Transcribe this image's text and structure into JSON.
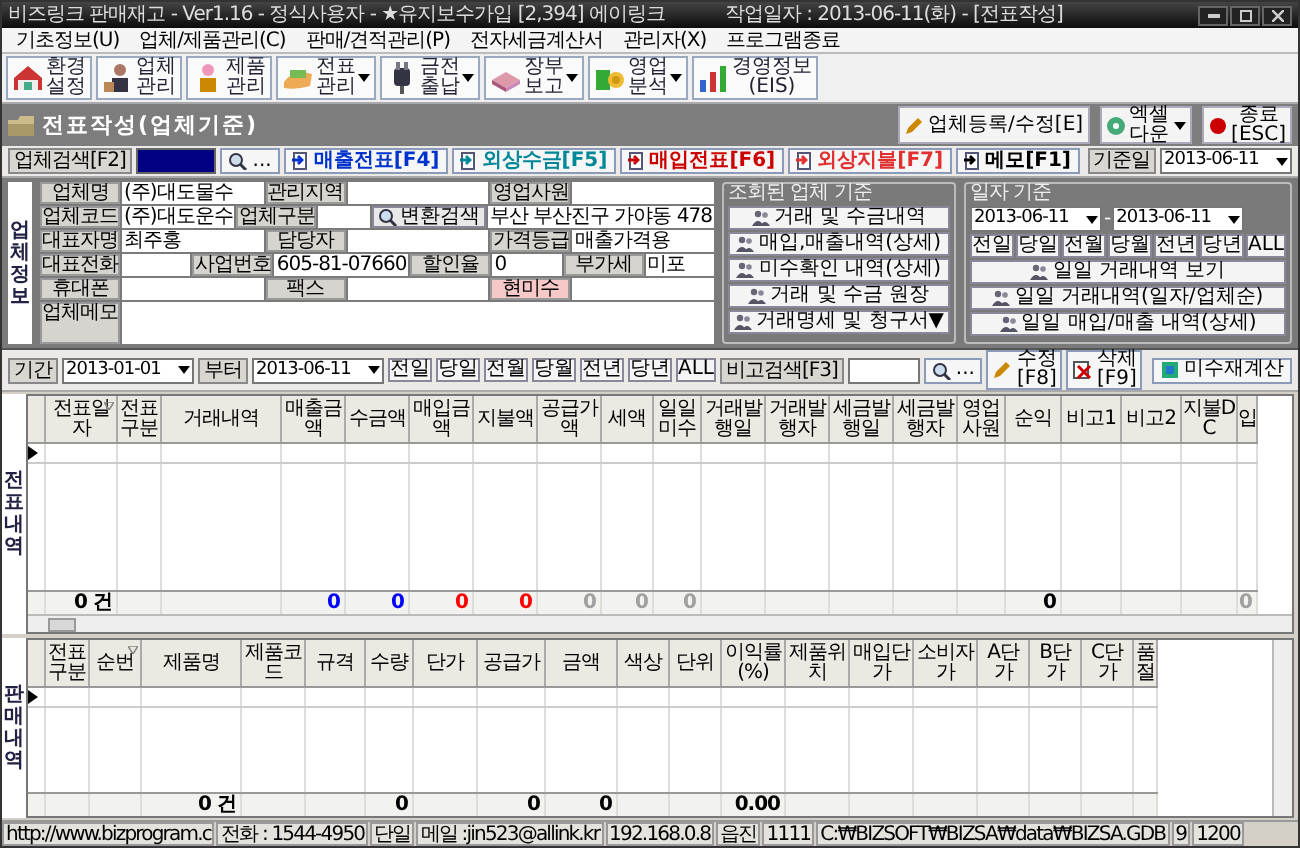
{
  "window": {
    "title": "비즈링크 판매재고 - Ver1.16 - 정식사용자 - ★유지보수가입 [2,394] 에이링크",
    "work_date": "작업일자 : 2013-06-11(화) - [전표작성]"
  },
  "menu": [
    "기초정보(U)",
    "업체/제품관리(C)",
    "판매/견적관리(P)",
    "전자세금계산서",
    "관리자(X)",
    "프로그램종료"
  ],
  "toolbar": [
    {
      "label": "환경\n설정",
      "dropdown": false
    },
    {
      "label": "업체\n관리",
      "dropdown": false
    },
    {
      "label": "제품\n관리",
      "dropdown": false
    },
    {
      "label": "전표\n관리",
      "dropdown": true
    },
    {
      "label": "금전\n출납",
      "dropdown": true
    },
    {
      "label": "장부\n보고",
      "dropdown": true
    },
    {
      "label": "영업\n분석",
      "dropdown": true
    },
    {
      "label": "경영정보\n(EIS)",
      "dropdown": false
    }
  ],
  "section": {
    "title": "전표작성(업체기준)",
    "buttons": [
      {
        "label": "업체등록/수정[E]",
        "dropdown": false
      },
      {
        "label": "엑셀\n다운",
        "dropdown": true
      },
      {
        "label": "종료\n[ESC]",
        "dropdown": false
      }
    ]
  },
  "search": {
    "label": "업체검색[F2]",
    "browse": "...",
    "actions": [
      {
        "label": "매출전표[F4]",
        "color": "#0033cc"
      },
      {
        "label": "외상수금[F5]",
        "color": "#008899"
      },
      {
        "label": "매입전표[F6]",
        "color": "#cc0000"
      },
      {
        "label": "외상지불[F7]",
        "color": "#e03030"
      },
      {
        "label": "메모[F1]",
        "color": "#000000"
      }
    ],
    "date_label": "기준일",
    "date": "2013-06-11"
  },
  "vendor": {
    "side_label": "업체정보",
    "rows": [
      {
        "kind": "line",
        "cells": [
          {
            "kind": "label",
            "text": "업체명"
          },
          {
            "kind": "value",
            "text": "(주)대도물수"
          },
          {
            "kind": "label",
            "text": "관리지역"
          },
          {
            "kind": "value"
          },
          {
            "kind": "label",
            "text": "영업사원"
          },
          {
            "kind": "value"
          }
        ]
      },
      {
        "kind": "line",
        "cells": [
          {
            "kind": "label",
            "text": "업체코드"
          },
          {
            "kind": "value",
            "text": "(주)대도운수"
          },
          {
            "kind": "label",
            "text": "업체구분"
          },
          {
            "kind": "value"
          },
          {
            "kind": "button",
            "text": "변환검색"
          },
          {
            "kind": "value",
            "text": "부산 부산진구 가야동 478"
          }
        ]
      },
      {
        "kind": "line",
        "cells": [
          {
            "kind": "label",
            "text": "대표자명"
          },
          {
            "kind": "value",
            "text": "최주홍"
          },
          {
            "kind": "label",
            "text": "담당자"
          },
          {
            "kind": "value"
          },
          {
            "kind": "label",
            "text": "가격등급"
          },
          {
            "kind": "value",
            "text": "매출가격용"
          }
        ]
      },
      {
        "kind": "line",
        "cells": [
          {
            "kind": "label",
            "text": "대표전화"
          },
          {
            "kind": "value"
          },
          {
            "kind": "label",
            "text": "사업번호"
          },
          {
            "kind": "value",
            "text": "605-81-07660"
          },
          {
            "kind": "label",
            "text": "할인율"
          },
          {
            "kind": "value",
            "text": "0"
          },
          {
            "kind": "label",
            "text": "부가세"
          },
          {
            "kind": "value",
            "text": "미포"
          }
        ]
      },
      {
        "kind": "line",
        "cells": [
          {
            "kind": "label",
            "text": "휴대폰"
          },
          {
            "kind": "value"
          },
          {
            "kind": "label",
            "text": "팩스"
          },
          {
            "kind": "value"
          },
          {
            "kind": "alert",
            "text": "현미수"
          },
          {
            "kind": "value"
          }
        ]
      },
      {
        "kind": "memo",
        "cells": [
          {
            "kind": "label",
            "text": "업체메모"
          },
          {
            "kind": "value"
          }
        ]
      }
    ]
  },
  "account_group": {
    "legend": "조회된 업체 기준",
    "buttons": [
      "거래 및 수금내역",
      "매입,매출내역(상세)",
      "미수확인 내역(상세)",
      "거래 및 수금 원장",
      "거래명세 및 청구서▼"
    ]
  },
  "date_group": {
    "legend": "일자 기준",
    "from": "2013-06-11",
    "separator": "-",
    "to": "2013-06-11",
    "quick": [
      "전일",
      "당일",
      "전월",
      "당월",
      "전년",
      "당년",
      "ALL"
    ],
    "buttons": [
      "일일 거래내역 보기",
      "일일 거래내역(일자/업체순)",
      "일일 매입/매출 내역(상세)"
    ]
  },
  "period": {
    "label": "기간",
    "from": "2013-01-01",
    "to_label": "부터",
    "to": "2013-06-11",
    "quick": [
      "전일",
      "당일",
      "전월",
      "당월",
      "전년",
      "당년",
      "ALL"
    ],
    "note_label": "비고검색[F3]",
    "browse": "...",
    "edit": "수정\n[F8]",
    "delete": "삭제\n[F9]",
    "recalc": "미수재계산"
  },
  "slips": {
    "side_label": "전표내역",
    "columns": [
      {
        "label": "전표일자",
        "filter": true,
        "total": {
          "text": "0 건",
          "color": "#000000"
        }
      },
      {
        "label": "전표구분",
        "filter": false
      },
      {
        "label": "거래내역",
        "filter": false
      },
      {
        "label": "매출금액",
        "filter": false,
        "total": {
          "text": "0",
          "color": "#0000ff"
        }
      },
      {
        "label": "수금액",
        "filter": false,
        "total": {
          "text": "0",
          "color": "#0000ff"
        }
      },
      {
        "label": "매입금액",
        "filter": false,
        "total": {
          "text": "0",
          "color": "#ff0000"
        }
      },
      {
        "label": "지불액",
        "filter": false,
        "total": {
          "text": "0",
          "color": "#ff0000"
        }
      },
      {
        "label": "공급가액",
        "filter": false,
        "total": {
          "text": "0",
          "color": "#a0a0a0"
        }
      },
      {
        "label": "세액",
        "filter": false,
        "total": {
          "text": "0",
          "color": "#a0a0a0"
        }
      },
      {
        "label": "일일미수",
        "filter": false,
        "total": {
          "text": "0",
          "color": "#a0a0a0"
        }
      },
      {
        "label": "거래발행일",
        "filter": false
      },
      {
        "label": "거래발행자",
        "filter": false
      },
      {
        "label": "세금발행일",
        "filter": false
      },
      {
        "label": "세금발행자",
        "filter": false
      },
      {
        "label": "영업사원",
        "filter": false
      },
      {
        "label": "순익",
        "filter": false,
        "total": {
          "text": "0",
          "color": "#000000"
        }
      },
      {
        "label": "비고1",
        "filter": false
      },
      {
        "label": "비고2",
        "filter": false
      },
      {
        "label": "지불DC",
        "filter": false
      },
      {
        "label": "입",
        "filter": false,
        "total": {
          "text": "0",
          "color": "#a0a0a0"
        }
      }
    ]
  },
  "sales": {
    "side_label": "판매내역",
    "columns": [
      {
        "label": "전표구분",
        "filter": false
      },
      {
        "label": "순번",
        "filter": true
      },
      {
        "label": "제품명",
        "filter": false,
        "total": {
          "text": "0 건",
          "color": "#000000"
        }
      },
      {
        "label": "제품코드",
        "filter": false
      },
      {
        "label": "규격",
        "filter": false
      },
      {
        "label": "수량",
        "filter": false,
        "total": {
          "text": "0",
          "color": "#000000"
        }
      },
      {
        "label": "단가",
        "filter": false
      },
      {
        "label": "공급가",
        "filter": false,
        "total": {
          "text": "0",
          "color": "#000000"
        }
      },
      {
        "label": "금액",
        "filter": false,
        "total": {
          "text": "0",
          "color": "#000000"
        }
      },
      {
        "label": "색상",
        "filter": false
      },
      {
        "label": "단위",
        "filter": false
      },
      {
        "label": "이익률(%)",
        "filter": false,
        "total": {
          "text": "0.00",
          "color": "#000000"
        }
      },
      {
        "label": "제품위치",
        "filter": false
      },
      {
        "label": "매입단가",
        "filter": false
      },
      {
        "label": "소비자가",
        "filter": false
      },
      {
        "label": "A단가",
        "filter": false
      },
      {
        "label": "B단가",
        "filter": false
      },
      {
        "label": "C단가",
        "filter": false
      },
      {
        "label": "품절",
        "filter": false
      }
    ]
  },
  "status_bar": [
    "http://www.bizprogram.c",
    "전화 : 1544-4950",
    "단일",
    "메일 :jin523@allink.kr",
    "192.168.0.8",
    "읍진",
    "1111",
    "C:₩BIZSOFT₩BIZSA₩data₩BIZSA.GDB",
    "9",
    "1200"
  ]
}
